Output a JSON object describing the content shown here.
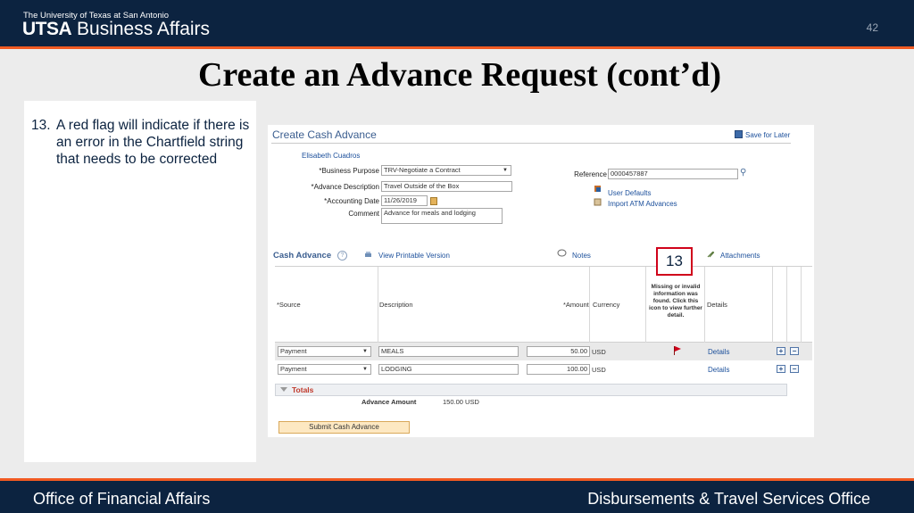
{
  "header": {
    "university": "The University of Texas at San Antonio",
    "utsa": "UTSA",
    "department": "Business Affairs",
    "page_number": "42"
  },
  "title": "Create an Advance Request (cont’d)",
  "instruction": {
    "number": "13.",
    "text": "A red flag will indicate if there is an error in the Chartfield string that needs to be corrected"
  },
  "app": {
    "title": "Create Cash Advance",
    "save_for_later": "Save for Later",
    "employee_name": "Elisabeth Cuadros",
    "fields": {
      "business_purpose_label": "*Business Purpose",
      "business_purpose_value": "TRV-Negotiate a Contract",
      "advance_description_label": "*Advance Description",
      "advance_description_value": "Travel Outside of the Box",
      "accounting_date_label": "*Accounting Date",
      "accounting_date_value": "11/26/2019",
      "comment_label": "Comment",
      "comment_value": "Advance for meals and lodging",
      "reference_label": "Reference",
      "reference_value": "0000457887"
    },
    "links": {
      "user_defaults": "User Defaults",
      "import_atm": "Import ATM Advances",
      "view_printable": "View Printable Version",
      "notes": "Notes",
      "attachments": "Attachments"
    },
    "cash_advance": {
      "label": "Cash Advance",
      "help": "?",
      "columns": {
        "source": "*Source",
        "description": "Description",
        "amount": "*Amount",
        "currency": "Currency",
        "flag_info": "Missing or invalid information was found. Click this icon to view further detail.",
        "details": "Details"
      },
      "rows": [
        {
          "source": "Payment",
          "description": "MEALS",
          "amount": "50.00",
          "currency": "USD",
          "details": "Details",
          "flag": true
        },
        {
          "source": "Payment",
          "description": "LODGING",
          "amount": "100.00",
          "currency": "USD",
          "details": "Details",
          "flag": false
        }
      ],
      "add": "+",
      "remove": "−"
    },
    "totals": {
      "label": "Totals",
      "advance_amount_label": "Advance Amount",
      "advance_amount_value": "150.00  USD"
    },
    "submit": "Submit Cash Advance",
    "callout": "13"
  },
  "footer": {
    "left": "Office of Financial Affairs",
    "right": "Disbursements & Travel Services Office"
  },
  "colors": {
    "navy": "#0c2340",
    "orange": "#f15a22",
    "link": "#1b4f9b",
    "flag": "#d0021b"
  }
}
